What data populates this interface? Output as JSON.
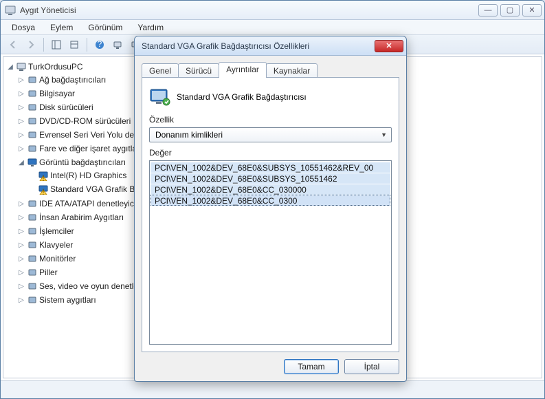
{
  "window": {
    "title": "Aygıt Yöneticisi",
    "controls": {
      "minimize": "—",
      "maximize": "▢",
      "close": "✕"
    }
  },
  "menubar": [
    "Dosya",
    "Eylem",
    "Görünüm",
    "Yardım"
  ],
  "tree": {
    "root": {
      "label": "TurkOrdusuPC"
    },
    "items": [
      {
        "label": "Ağ bağdaştırıcıları"
      },
      {
        "label": "Bilgisayar"
      },
      {
        "label": "Disk sürücüleri"
      },
      {
        "label": "DVD/CD-ROM sürücüleri"
      },
      {
        "label": "Evrensel Seri Veri Yolu denetleyicileri"
      },
      {
        "label": "Fare ve diğer işaret aygıtları"
      },
      {
        "label": "Görüntü bağdaştırıcıları",
        "expanded": true,
        "children": [
          {
            "label": "Intel(R) HD Graphics",
            "warn": true
          },
          {
            "label": "Standard VGA Grafik Bağdaştırıcısı",
            "warn": true
          }
        ]
      },
      {
        "label": "IDE ATA/ATAPI denetleyicileri"
      },
      {
        "label": "İnsan Arabirim Aygıtları"
      },
      {
        "label": "İşlemciler"
      },
      {
        "label": "Klavyeler"
      },
      {
        "label": "Monitörler"
      },
      {
        "label": "Piller"
      },
      {
        "label": "Ses, video ve oyun denetleyicileri"
      },
      {
        "label": "Sistem aygıtları"
      }
    ]
  },
  "dialog": {
    "title": "Standard VGA Grafik Bağdaştırıcısı Özellikleri",
    "tabs": [
      "Genel",
      "Sürücü",
      "Ayrıntılar",
      "Kaynaklar"
    ],
    "active_tab": 2,
    "device_name": "Standard VGA Grafik Bağdaştırıcısı",
    "property_label": "Özellik",
    "property_selected": "Donanım kimlikleri",
    "value_label": "Değer",
    "values": [
      "PCI\\VEN_1002&DEV_68E0&SUBSYS_10551462&REV_00",
      "PCI\\VEN_1002&DEV_68E0&SUBSYS_10551462",
      "PCI\\VEN_1002&DEV_68E0&CC_030000",
      "PCI\\VEN_1002&DEV_68E0&CC_0300"
    ],
    "selected_value_index": 3,
    "buttons": {
      "ok": "Tamam",
      "cancel": "İptal"
    }
  }
}
